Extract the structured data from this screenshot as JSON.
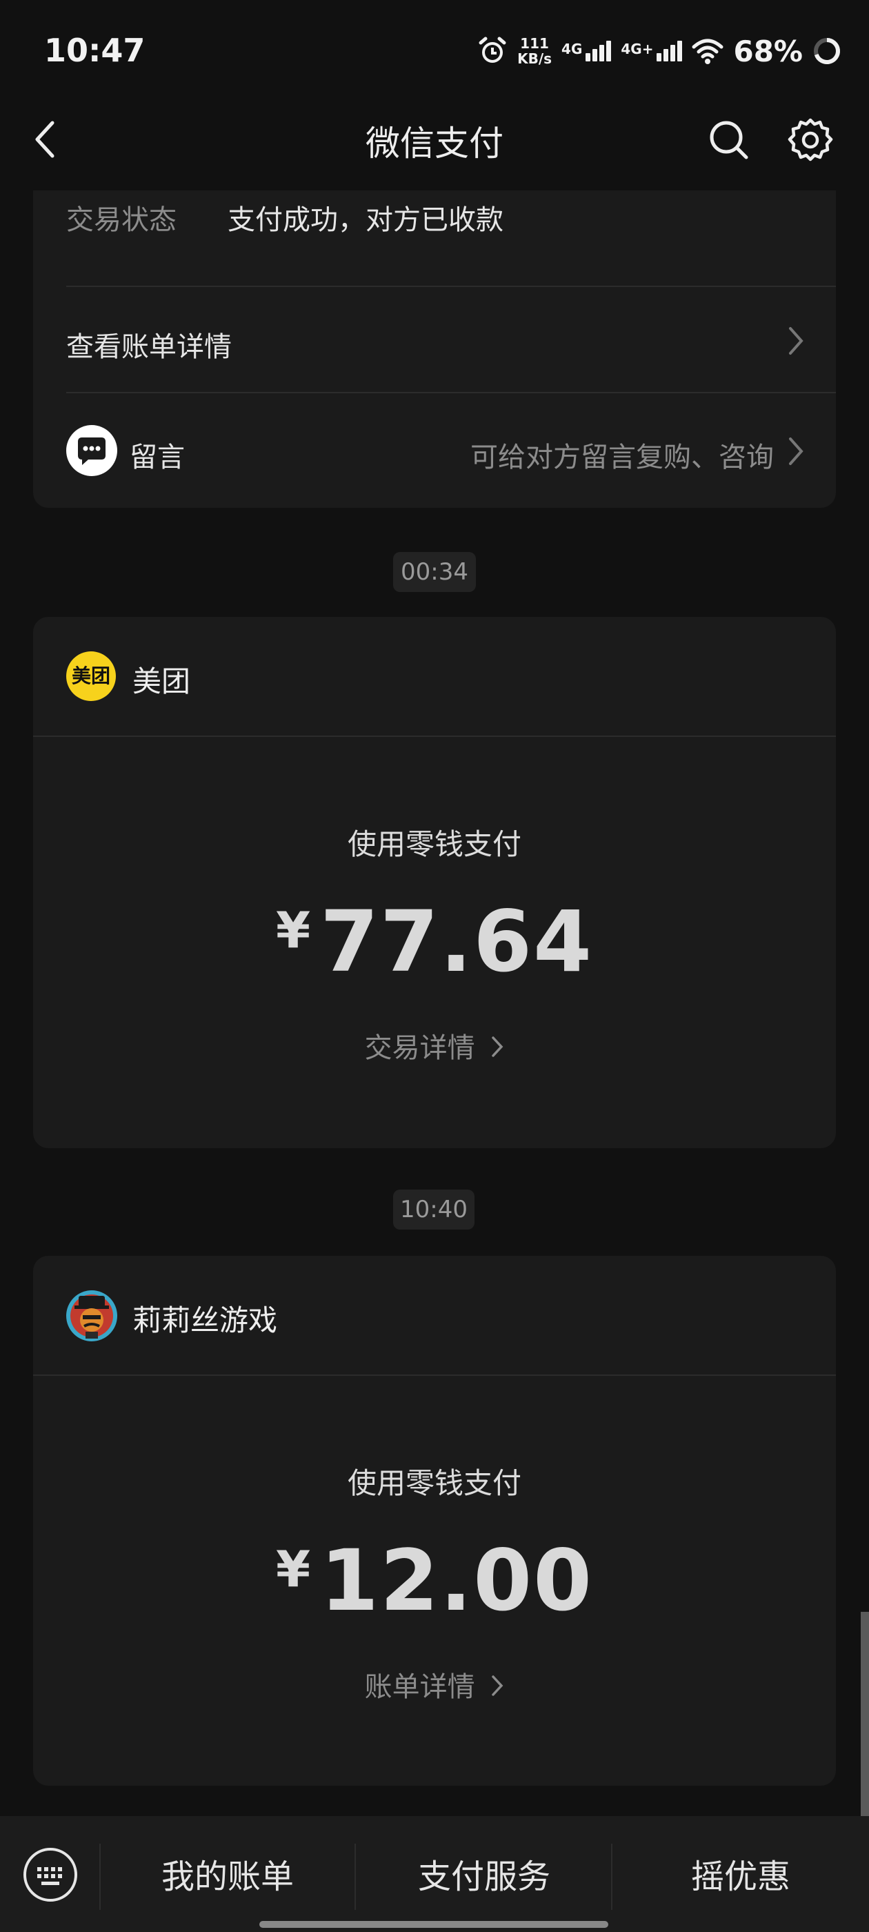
{
  "status_bar": {
    "time": "10:47",
    "speed_value": "111",
    "speed_unit": "KB/s",
    "net1": "4G",
    "net2": "4G+",
    "battery": "68%"
  },
  "header": {
    "title": "微信支付",
    "icons": [
      "back-arrow-icon",
      "search-icon",
      "gear-icon"
    ]
  },
  "top_card": {
    "status_label": "交易状态",
    "status_value": "支付成功，对方已收款",
    "bill_detail_label": "查看账单详情",
    "message_label": "留言",
    "message_hint": "可给对方留言复购、咨询"
  },
  "transactions": [
    {
      "time": "00:34",
      "merchant": "美团",
      "logo_text": "美团",
      "pay_method": "使用零钱支付",
      "currency": "¥",
      "amount": "77.64",
      "detail_link": "交易详情"
    },
    {
      "time": "10:40",
      "merchant": "莉莉丝游戏",
      "pay_method": "使用零钱支付",
      "currency": "¥",
      "amount": "12.00",
      "detail_link": "账单详情"
    }
  ],
  "bottom_bar": {
    "tabs": [
      "我的账单",
      "支付服务",
      "摇优惠"
    ]
  },
  "colors": {
    "background": "#111111",
    "card": "#1b1b1b",
    "meituan_yellow": "#f7d21c",
    "text": "#e8e8e8",
    "muted": "#8c8c8c"
  }
}
